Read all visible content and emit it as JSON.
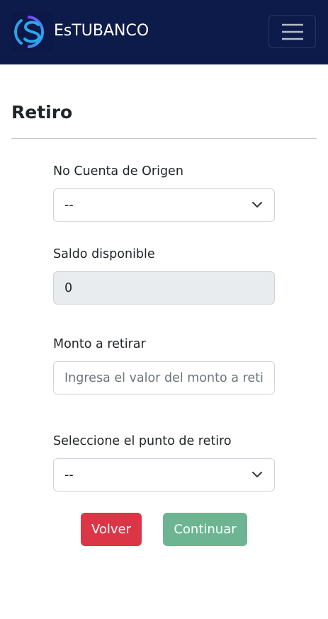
{
  "navbar": {
    "brand_name": "EsTUBANCO",
    "logo_icon": "dollar-s-logo-icon",
    "toggler_icon": "hamburger-menu-icon",
    "background": "#0d1b4b"
  },
  "page": {
    "title": "Retiro"
  },
  "form": {
    "origin_account": {
      "label": "No Cuenta de Origen",
      "value": "--"
    },
    "available_balance": {
      "label": "Saldo disponible",
      "value": "0"
    },
    "amount": {
      "label": "Monto a retirar",
      "placeholder": "Ingresa el valor del monto a reti"
    },
    "withdraw_point": {
      "label": "Seleccione el punto de retiro",
      "value": "--"
    }
  },
  "buttons": {
    "back_label": "Volver",
    "continue_label": "Continuar",
    "back_color": "#dc3545",
    "continue_color": "#6db592"
  }
}
